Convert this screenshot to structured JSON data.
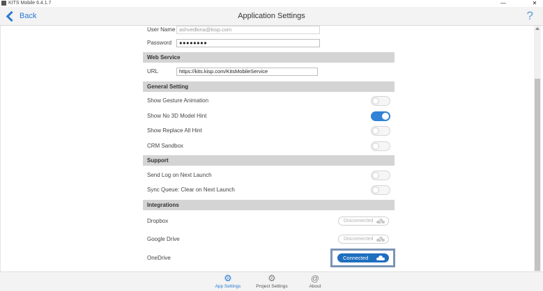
{
  "window": {
    "title": "KITS Mobile 6.4.1.7",
    "minimize": "—",
    "close": "✕"
  },
  "nav": {
    "back_label": "Back",
    "title": "Application Settings",
    "help_glyph": "?"
  },
  "fields": {
    "user_name": {
      "label": "User Name",
      "value": "ashvedkina@kisp.com"
    },
    "password": {
      "label": "Password",
      "value": "●●●●●●●●"
    }
  },
  "sections": {
    "web_service": "Web Service",
    "general": "General Setting",
    "support": "Support",
    "integrations": "Integrations"
  },
  "url": {
    "label": "URL",
    "value": "https://kits.kisp.com/KitsMobileService"
  },
  "general_toggles": [
    {
      "label": "Show Gesture Animation",
      "on": false
    },
    {
      "label": "Show No 3D Model Hint",
      "on": true
    },
    {
      "label": "Show Replace All Hint",
      "on": false
    },
    {
      "label": "CRM Sandbox",
      "on": false
    }
  ],
  "support_toggles": [
    {
      "label": "Send Log on Next Launch",
      "on": false
    },
    {
      "label": "Sync Queue: Clear on Next Launch",
      "on": false
    }
  ],
  "integrations": [
    {
      "name": "Dropbox",
      "status": "Disconnected"
    },
    {
      "name": "Google Drive",
      "status": "Disconnected"
    },
    {
      "name": "OneDrive",
      "status": "Connected"
    }
  ],
  "tabs": [
    {
      "label": "App Settings",
      "active": true
    },
    {
      "label": "Project Settings",
      "active": false
    },
    {
      "label": "About",
      "active": false
    }
  ],
  "colors": {
    "accent": "#2a7bd4",
    "section_bg": "#d4d4d4",
    "connected_bg": "#1f6fbf"
  }
}
